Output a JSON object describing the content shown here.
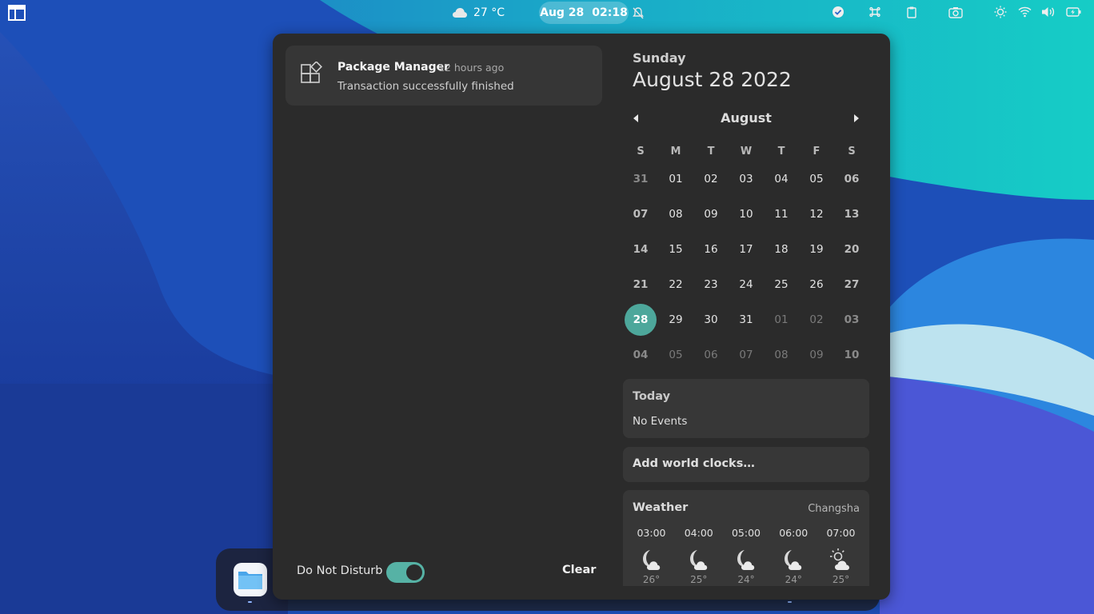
{
  "topbar": {
    "weather_temp": "27 °C",
    "clock_date": "Aug 28",
    "clock_time": "02:18"
  },
  "notification": {
    "app": "Package Manager",
    "time": "12 hours ago",
    "body": "Transaction successfully finished"
  },
  "footer": {
    "dnd_label": "Do Not Disturb",
    "dnd_on": true,
    "clear_label": "Clear"
  },
  "date": {
    "day_name": "Sunday",
    "full": "August 28 2022"
  },
  "calendar": {
    "month": "August",
    "weekdays": [
      "S",
      "M",
      "T",
      "W",
      "T",
      "F",
      "S"
    ],
    "weeks": [
      [
        "31",
        "01",
        "02",
        "03",
        "04",
        "05",
        "06"
      ],
      [
        "07",
        "08",
        "09",
        "10",
        "11",
        "12",
        "13"
      ],
      [
        "14",
        "15",
        "16",
        "17",
        "18",
        "19",
        "20"
      ],
      [
        "21",
        "22",
        "23",
        "24",
        "25",
        "26",
        "27"
      ],
      [
        "28",
        "29",
        "30",
        "31",
        "01",
        "02",
        "03"
      ],
      [
        "04",
        "05",
        "06",
        "07",
        "08",
        "09",
        "10"
      ]
    ],
    "today": "28",
    "accent": "#4da79b"
  },
  "events": {
    "title": "Today",
    "empty": "No Events"
  },
  "world_clocks": {
    "label": "Add world clocks…"
  },
  "weather": {
    "title": "Weather",
    "city": "Changsha",
    "forecast": [
      {
        "time": "03:00",
        "icon": "night-cloudy-icon",
        "temp": "26°"
      },
      {
        "time": "04:00",
        "icon": "night-cloudy-icon",
        "temp": "25°"
      },
      {
        "time": "05:00",
        "icon": "night-cloudy-icon",
        "temp": "24°"
      },
      {
        "time": "06:00",
        "icon": "night-cloudy-icon",
        "temp": "24°"
      },
      {
        "time": "07:00",
        "icon": "day-cloudy-icon",
        "temp": "25°"
      }
    ]
  },
  "dock": {
    "apps": [
      "files-icon"
    ]
  }
}
